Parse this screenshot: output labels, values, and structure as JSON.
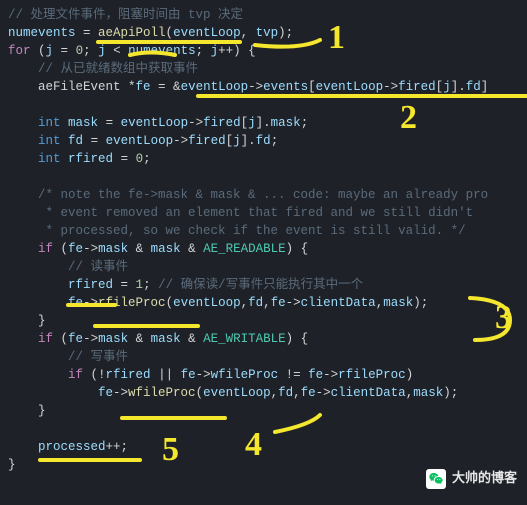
{
  "code": {
    "c1": "// 处理文件事件，阻塞时间由 tvp 决定",
    "l2_a": "numevents",
    "l2_b": " = ",
    "l2_c": "aeApiPoll",
    "l2_d": "(",
    "l2_e": "eventLoop",
    "l2_f": ", ",
    "l2_g": "tvp",
    "l2_h": ");",
    "l3_a": "for",
    "l3_b": " (",
    "l3_c": "j",
    "l3_d": " = ",
    "l3_e": "0",
    "l3_f": "; ",
    "l3_g": "j",
    "l3_h": " < ",
    "l3_i": "numevents",
    "l3_j": "; ",
    "l3_k": "j",
    "l3_l": "++) {",
    "c4": "    // 从已就绪数组中获取事件",
    "l5_a": "    aeFileEvent *",
    "l5_b": "fe",
    "l5_c": " = &",
    "l5_d": "eventLoop",
    "l5_e": "->",
    "l5_f": "events",
    "l5_g": "[",
    "l5_h": "eventLoop",
    "l5_i": "->",
    "l5_j": "fired",
    "l5_k": "[",
    "l5_l": "j",
    "l5_m": "].",
    "l5_n": "fd",
    "l5_o": "]",
    "l7_a": "    ",
    "l7_b": "int",
    "l7_c": " ",
    "l7_d": "mask",
    "l7_e": " = ",
    "l7_f": "eventLoop",
    "l7_g": "->",
    "l7_h": "fired",
    "l7_i": "[",
    "l7_j": "j",
    "l7_k": "].",
    "l7_l": "mask",
    "l7_m": ";",
    "l8_a": "    ",
    "l8_b": "int",
    "l8_c": " ",
    "l8_d": "fd",
    "l8_e": " = ",
    "l8_f": "eventLoop",
    "l8_g": "->",
    "l8_h": "fired",
    "l8_i": "[",
    "l8_j": "j",
    "l8_k": "].",
    "l8_l": "fd",
    "l8_m": ";",
    "l9_a": "    ",
    "l9_b": "int",
    "l9_c": " ",
    "l9_d": "rfired",
    "l9_e": " = ",
    "l9_f": "0",
    "l9_g": ";",
    "c11": "    /* note the fe->mask & mask & ... code: maybe an already pro",
    "c12": "     * event removed an element that fired and we still didn't",
    "c13": "     * processed, so we check if the event is still valid. */",
    "l14_a": "    ",
    "l14_b": "if",
    "l14_c": " (",
    "l14_d": "fe",
    "l14_e": "->",
    "l14_f": "mask",
    "l14_g": " & ",
    "l14_h": "mask",
    "l14_i": " & ",
    "l14_j": "AE_READABLE",
    "l14_k": ") {",
    "c15": "        // 读事件",
    "l16_a": "        ",
    "l16_b": "rfired",
    "l16_c": " = ",
    "l16_d": "1",
    "l16_e": "; ",
    "l16_f": "// 确保读/写事件只能执行其中一个",
    "l17_a": "        ",
    "l17_b": "fe",
    "l17_c": "->",
    "l17_d": "rfileProc",
    "l17_e": "(",
    "l17_f": "eventLoop",
    "l17_g": ",",
    "l17_h": "fd",
    "l17_i": ",",
    "l17_j": "fe",
    "l17_k": "->",
    "l17_l": "clientData",
    "l17_m": ",",
    "l17_n": "mask",
    "l17_o": ");",
    "l18": "    }",
    "l19_a": "    ",
    "l19_b": "if",
    "l19_c": " (",
    "l19_d": "fe",
    "l19_e": "->",
    "l19_f": "mask",
    "l19_g": " & ",
    "l19_h": "mask",
    "l19_i": " & ",
    "l19_j": "AE_WRITABLE",
    "l19_k": ") {",
    "c20": "        // 写事件",
    "l21_a": "        ",
    "l21_b": "if",
    "l21_c": " (!",
    "l21_d": "rfired",
    "l21_e": " || ",
    "l21_f": "fe",
    "l21_g": "->",
    "l21_h": "wfileProc",
    "l21_i": " != ",
    "l21_j": "fe",
    "l21_k": "->",
    "l21_l": "rfileProc",
    "l21_m": ")",
    "l22_a": "            ",
    "l22_b": "fe",
    "l22_c": "->",
    "l22_d": "wfileProc",
    "l22_e": "(",
    "l22_f": "eventLoop",
    "l22_g": ",",
    "l22_h": "fd",
    "l22_i": ",",
    "l22_j": "fe",
    "l22_k": "->",
    "l22_l": "clientData",
    "l22_m": ",",
    "l22_n": "mask",
    "l22_o": ");",
    "l23": "    }",
    "l25_a": "    ",
    "l25_b": "processed",
    "l25_c": "++;",
    "l26": "}"
  },
  "ann": {
    "n1": "1",
    "n2": "2",
    "n3": "3",
    "n4": "4",
    "n5": "5"
  },
  "watermark": {
    "text": "大帅的博客"
  }
}
